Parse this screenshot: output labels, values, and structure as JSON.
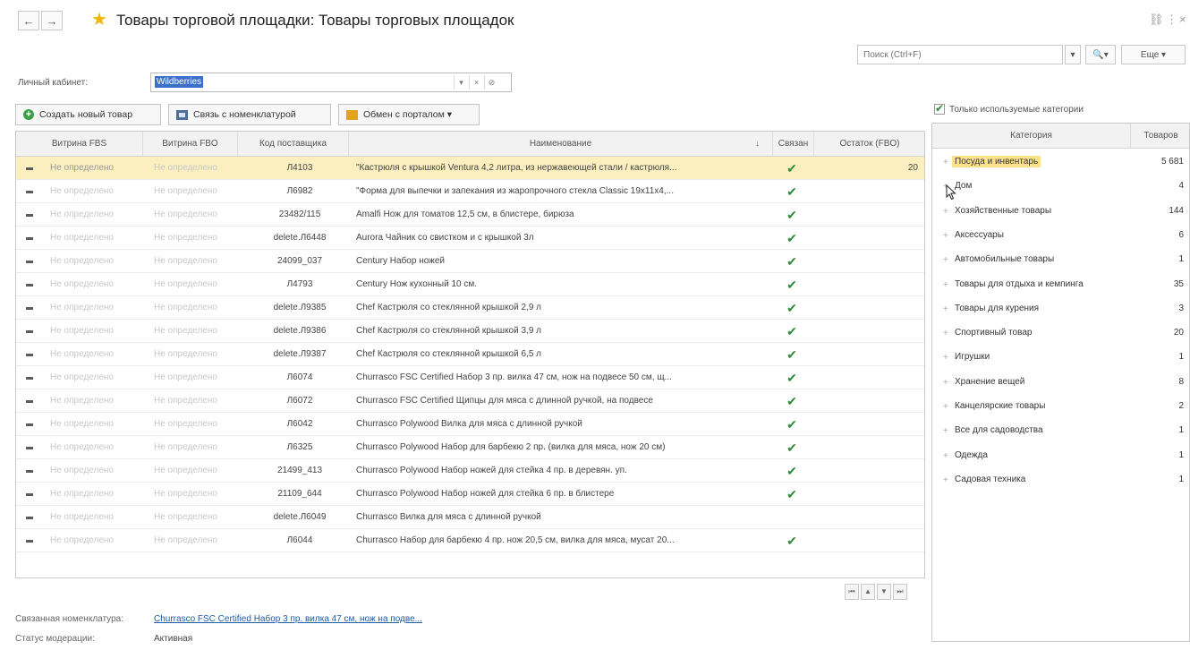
{
  "window": {
    "title": "Товары торговой площадки: Товары торговых площадок",
    "back": "←",
    "forward": "→",
    "link_icon": "⛓",
    "more_icon": "⋮",
    "close_icon": "×"
  },
  "search": {
    "placeholder": "Поиск (Ctrl+F)",
    "dropdown": "▾",
    "find": "🔍▾",
    "more_label": "Еще ▾"
  },
  "cabinet": {
    "label": "Личный кабинет:",
    "value": "Wildberries",
    "dropdown": "▾",
    "clear": "×",
    "open": "⊘"
  },
  "toolbar": {
    "create": "Создать новый товар",
    "link": "Связь с номенклатурой",
    "exchange": "Обмен с порталом ▾"
  },
  "grid": {
    "columns": {
      "fbs": "Витрина FBS",
      "fbo": "Витрина FBO",
      "code": "Код поставщика",
      "name": "Наименование",
      "sort": "↓",
      "linked": "Связан",
      "stock": "Остаток (FBO)"
    },
    "rows": [
      {
        "fbs": "Не определено",
        "fbo": "Не определено",
        "code": "Л4103",
        "name": "\"Кастрюля с крышкой Ventura 4,2 литра, из нержавеющей стали / кастрюля...",
        "linked": "✔",
        "stock": "20"
      },
      {
        "fbs": "Не определено",
        "fbo": "Не определено",
        "code": "Л6982",
        "name": "\"Форма для выпечки и запекания из жаропрочного стекла Classic 19x11x4,...",
        "linked": "✔",
        "stock": ""
      },
      {
        "fbs": "Не определено",
        "fbo": "Не определено",
        "code": "23482/115",
        "name": "Amalfi Нож для томатов 12,5 см, в блистере, бирюза",
        "linked": "✔",
        "stock": ""
      },
      {
        "fbs": "Не определено",
        "fbo": "Не определено",
        "code": "delete.Л6448",
        "name": "Aurora Чайник со свистком и с крышкой 3л",
        "linked": "✔",
        "stock": ""
      },
      {
        "fbs": "Не определено",
        "fbo": "Не определено",
        "code": "24099_037",
        "name": "Century Набор ножей",
        "linked": "✔",
        "stock": ""
      },
      {
        "fbs": "Не определено",
        "fbo": "Не определено",
        "code": "Л4793",
        "name": "Century Нож кухонный 10 см.",
        "linked": "✔",
        "stock": ""
      },
      {
        "fbs": "Не определено",
        "fbo": "Не определено",
        "code": "delete.Л9385",
        "name": "Chef Кастрюля со стеклянной крышкой 2,9 л",
        "linked": "✔",
        "stock": ""
      },
      {
        "fbs": "Не определено",
        "fbo": "Не определено",
        "code": "delete.Л9386",
        "name": "Chef Кастрюля со стеклянной крышкой 3,9 л",
        "linked": "✔",
        "stock": ""
      },
      {
        "fbs": "Не определено",
        "fbo": "Не определено",
        "code": "delete.Л9387",
        "name": "Chef Кастрюля со стеклянной крышкой 6,5 л",
        "linked": "✔",
        "stock": ""
      },
      {
        "fbs": "Не определено",
        "fbo": "Не определено",
        "code": "Л6074",
        "name": "Churrasco FSC Certified Набор 3 пр. вилка 47 см, нож на подвесе 50 см, щ...",
        "linked": "✔",
        "stock": ""
      },
      {
        "fbs": "Не определено",
        "fbo": "Не определено",
        "code": "Л6072",
        "name": "Churrasco FSC Certified Щипцы для мяса с длинной ручкой, на подвесе",
        "linked": "✔",
        "stock": ""
      },
      {
        "fbs": "Не определено",
        "fbo": "Не определено",
        "code": "Л6042",
        "name": "Churrasco Polywood Вилка для мяса с длинной ручкой",
        "linked": "✔",
        "stock": ""
      },
      {
        "fbs": "Не определено",
        "fbo": "Не определено",
        "code": "Л6325",
        "name": "Churrasco Polywood Набор для барбекю 2 пр. (вилка для мяса, нож 20 см)",
        "linked": "✔",
        "stock": ""
      },
      {
        "fbs": "Не определено",
        "fbo": "Не определено",
        "code": "21499_413",
        "name": "Churrasco Polywood Набор ножей для стейка 4 пр. в деревян. уп.",
        "linked": "✔",
        "stock": ""
      },
      {
        "fbs": "Не определено",
        "fbo": "Не определено",
        "code": "21109_644",
        "name": "Churrasco Polywood Набор ножей для стейка 6 пр. в блистере",
        "linked": "✔",
        "stock": ""
      },
      {
        "fbs": "Не определено",
        "fbo": "Не определено",
        "code": "delete.Л6049",
        "name": "Churrasco Вилка для мяса с длинной ручкой",
        "linked": "",
        "stock": ""
      },
      {
        "fbs": "Не определено",
        "fbo": "Не определено",
        "code": "Л6044",
        "name": "Churrasco Набор для барбекю 4 пр. нож 20,5 см, вилка для мяса, мусат 20...",
        "linked": "✔",
        "stock": ""
      }
    ]
  },
  "pager": {
    "first": "⏮",
    "prev": "▲",
    "next": "▼",
    "last": "⏭"
  },
  "footer": {
    "linked_label": "Связанная номенклатура:",
    "linked_value": "Churrasco FSC Certified Набор 3 пр. вилка 47 см, нож на подве...",
    "status_label": "Статус модерации:",
    "status_value": "Активная"
  },
  "categories": {
    "only_used": "Только используемые категории",
    "col_category": "Категория",
    "col_count": "Товаров",
    "items": [
      {
        "name": "Посуда и инвентарь",
        "count": "5 681"
      },
      {
        "name": "Дом",
        "count": "4"
      },
      {
        "name": "Хозяйственные товары",
        "count": "144"
      },
      {
        "name": "Аксессуары",
        "count": "6"
      },
      {
        "name": "Автомобильные товары",
        "count": "1"
      },
      {
        "name": "Товары для отдыха и кемпинга",
        "count": "35"
      },
      {
        "name": "Товары для курения",
        "count": "3"
      },
      {
        "name": "Спортивный товар",
        "count": "20"
      },
      {
        "name": "Игрушки",
        "count": "1"
      },
      {
        "name": "Хранение вещей",
        "count": "8"
      },
      {
        "name": "Канцелярские товары",
        "count": "2"
      },
      {
        "name": "Все для садоводства",
        "count": "1"
      },
      {
        "name": "Одежда",
        "count": "1"
      },
      {
        "name": "Садовая техника",
        "count": "1"
      }
    ]
  },
  "colors": {
    "selected_row": "#fbefc0",
    "selected_category": "#fbe28a",
    "accent_blue": "#3c6fcb",
    "check_green": "#2e8b3a",
    "star_yellow": "#f2b600"
  }
}
